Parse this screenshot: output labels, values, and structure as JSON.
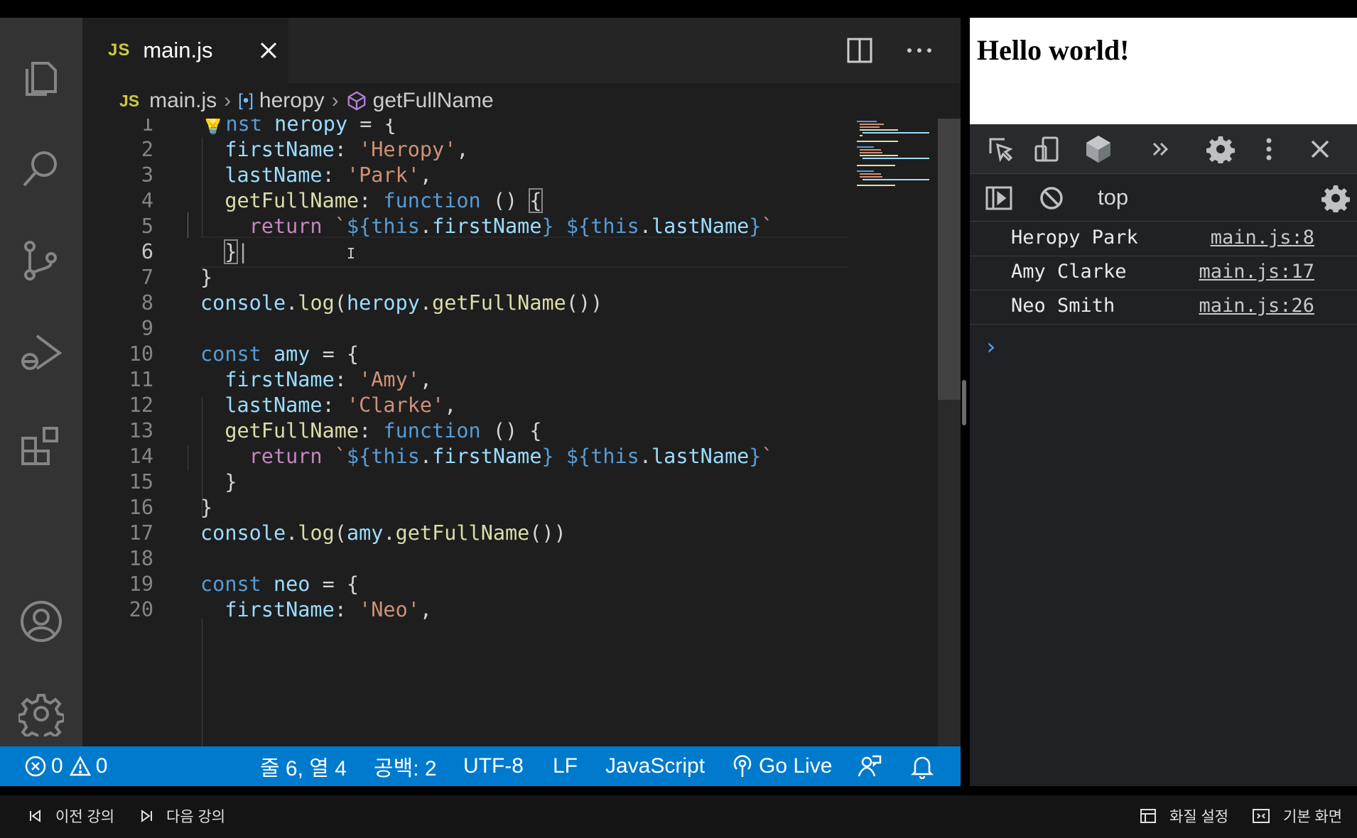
{
  "editor": {
    "tab": {
      "badge": "JS",
      "label": "main.js"
    },
    "breadcrumb": {
      "file_badge": "JS",
      "file": "main.js",
      "var_icon": "[•]",
      "variable": "heropy",
      "method": "getFullName"
    },
    "lines": [
      "1",
      "2",
      "3",
      "4",
      "5",
      "6",
      "7",
      "8",
      "9",
      "10",
      "11",
      "12",
      "13",
      "14",
      "15",
      "16",
      "17",
      "18",
      "19",
      "20"
    ],
    "current_line": "6"
  },
  "statusbar": {
    "errors": "0",
    "warnings": "0",
    "position": "줄 6, 열 4",
    "spaces": "공백: 2",
    "encoding": "UTF-8",
    "eol": "LF",
    "language": "JavaScript",
    "go_live": "Go Live"
  },
  "browser": {
    "heading": "Hello world!",
    "context": "top",
    "console": [
      {
        "text": "Heropy Park",
        "source": "main.js:8"
      },
      {
        "text": "Amy Clarke",
        "source": "main.js:17"
      },
      {
        "text": "Neo Smith",
        "source": "main.js:26"
      }
    ],
    "prompt": "›"
  },
  "player": {
    "prev": "이전 강의",
    "next": "다음 강의",
    "quality": "화질 설정",
    "view": "기본 화면"
  },
  "colors": {
    "statusbar": "#007acc",
    "activity_bar": "#333333",
    "editor_bg": "#1e1e1e",
    "keyword": "#569cd6",
    "string": "#ce9178",
    "function": "#dcdcaa",
    "variable": "#9cdcfe"
  },
  "icons": {
    "activity": [
      "files-icon",
      "search-icon",
      "source-control-icon",
      "run-debug-icon",
      "extensions-icon",
      "account-icon",
      "settings-gear-icon"
    ],
    "devtools": [
      "inspect-element-icon",
      "device-toolbar-icon",
      "cube-icon",
      "more-tabs-icon",
      "settings-gear-icon",
      "kebab-menu-icon",
      "close-icon"
    ]
  }
}
